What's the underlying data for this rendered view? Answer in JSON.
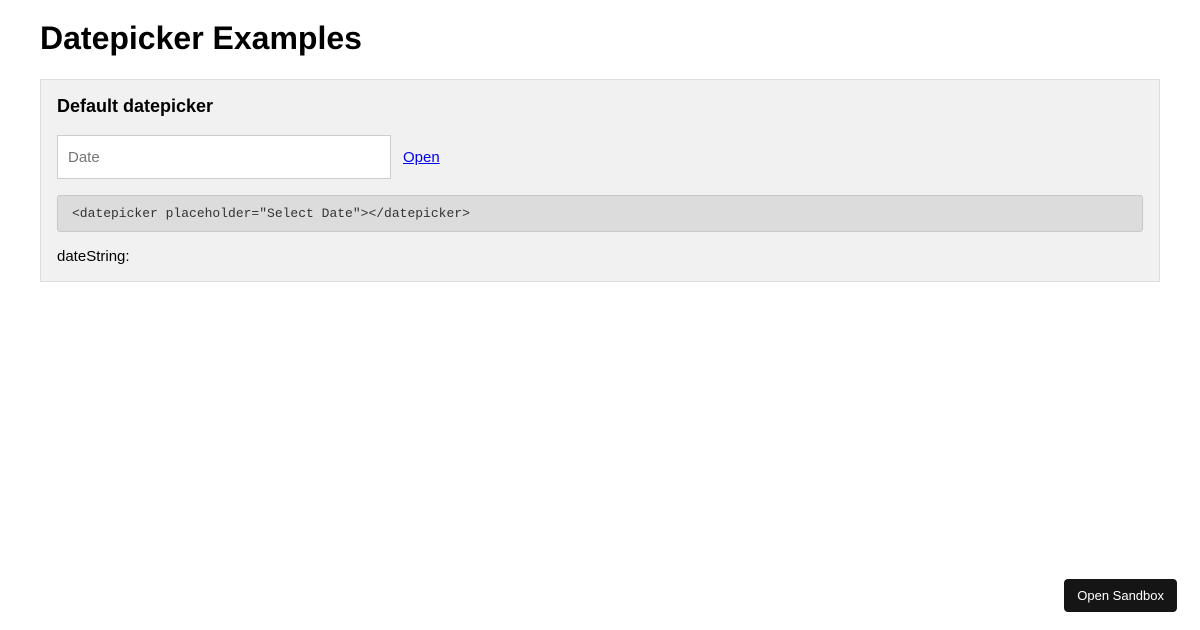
{
  "page": {
    "title": "Datepicker Examples"
  },
  "example": {
    "heading": "Default datepicker",
    "input_placeholder": "Date",
    "input_value": "",
    "open_link_label": "Open",
    "code_snippet": "<datepicker placeholder=\"Select Date\"></datepicker>",
    "status_label": "dateString:",
    "status_value": ""
  },
  "sandbox_button_label": "Open Sandbox"
}
